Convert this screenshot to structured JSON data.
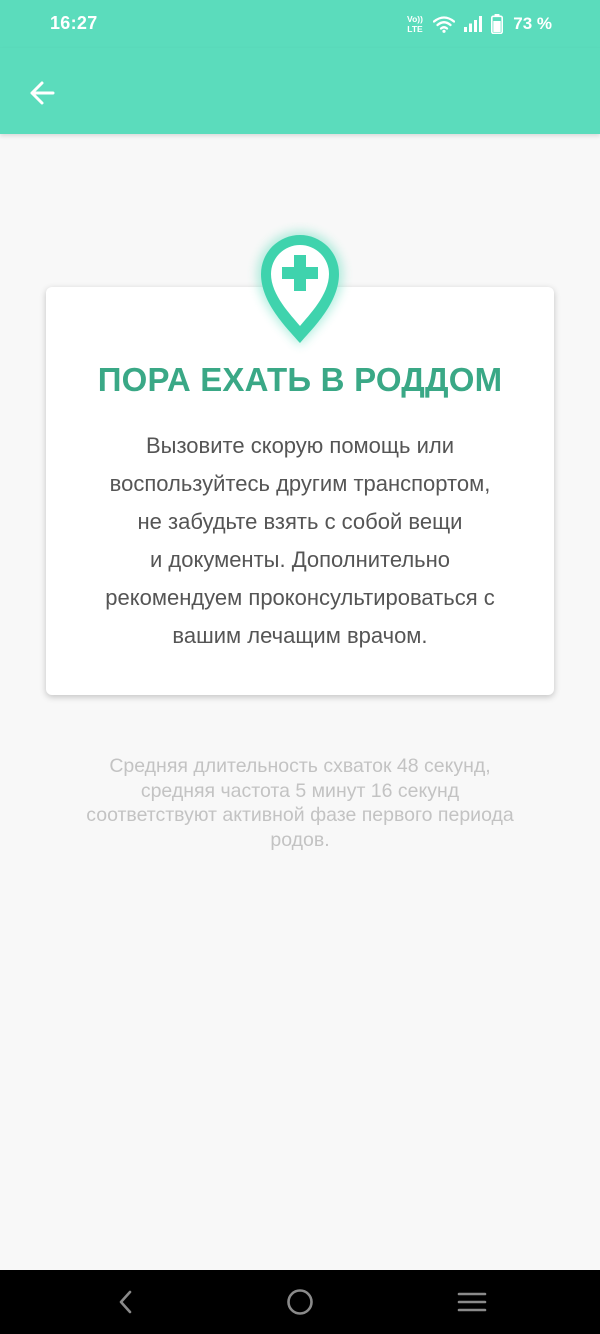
{
  "status_bar": {
    "time": "16:27",
    "volte_label": "Vo))",
    "lte_label": "LTE",
    "battery_percent": "73 %",
    "battery_level": 73
  },
  "app_bar": {
    "back_icon": "arrow-back-icon"
  },
  "card": {
    "icon": "map-pin-medical-cross-icon",
    "title": "ПОРА ЕХАТЬ В РОДДОМ",
    "body": "Вызовите скорую помощь или\nвоспользуйтесь другим транспортом,\nне забудьте взять с собой вещи\nи документы. Дополнительно\nрекомендуем проконсультироваться с\nвашим лечащим врачом."
  },
  "footnote": "Средняя длительность схваток 48 секунд,\nсредняя частота 5 минут 16 секунд\nсоответствуют активной фазе первого периода\nродов.",
  "nav_bar": {
    "back_icon": "nav-back-icon",
    "home_icon": "nav-home-icon",
    "menu_icon": "nav-menu-icon"
  },
  "colors": {
    "accent": "#5bdcbc",
    "title": "#3aa886",
    "body_text": "#555555",
    "footnote_text": "#c3c3c3",
    "background": "#f8f8f8"
  }
}
